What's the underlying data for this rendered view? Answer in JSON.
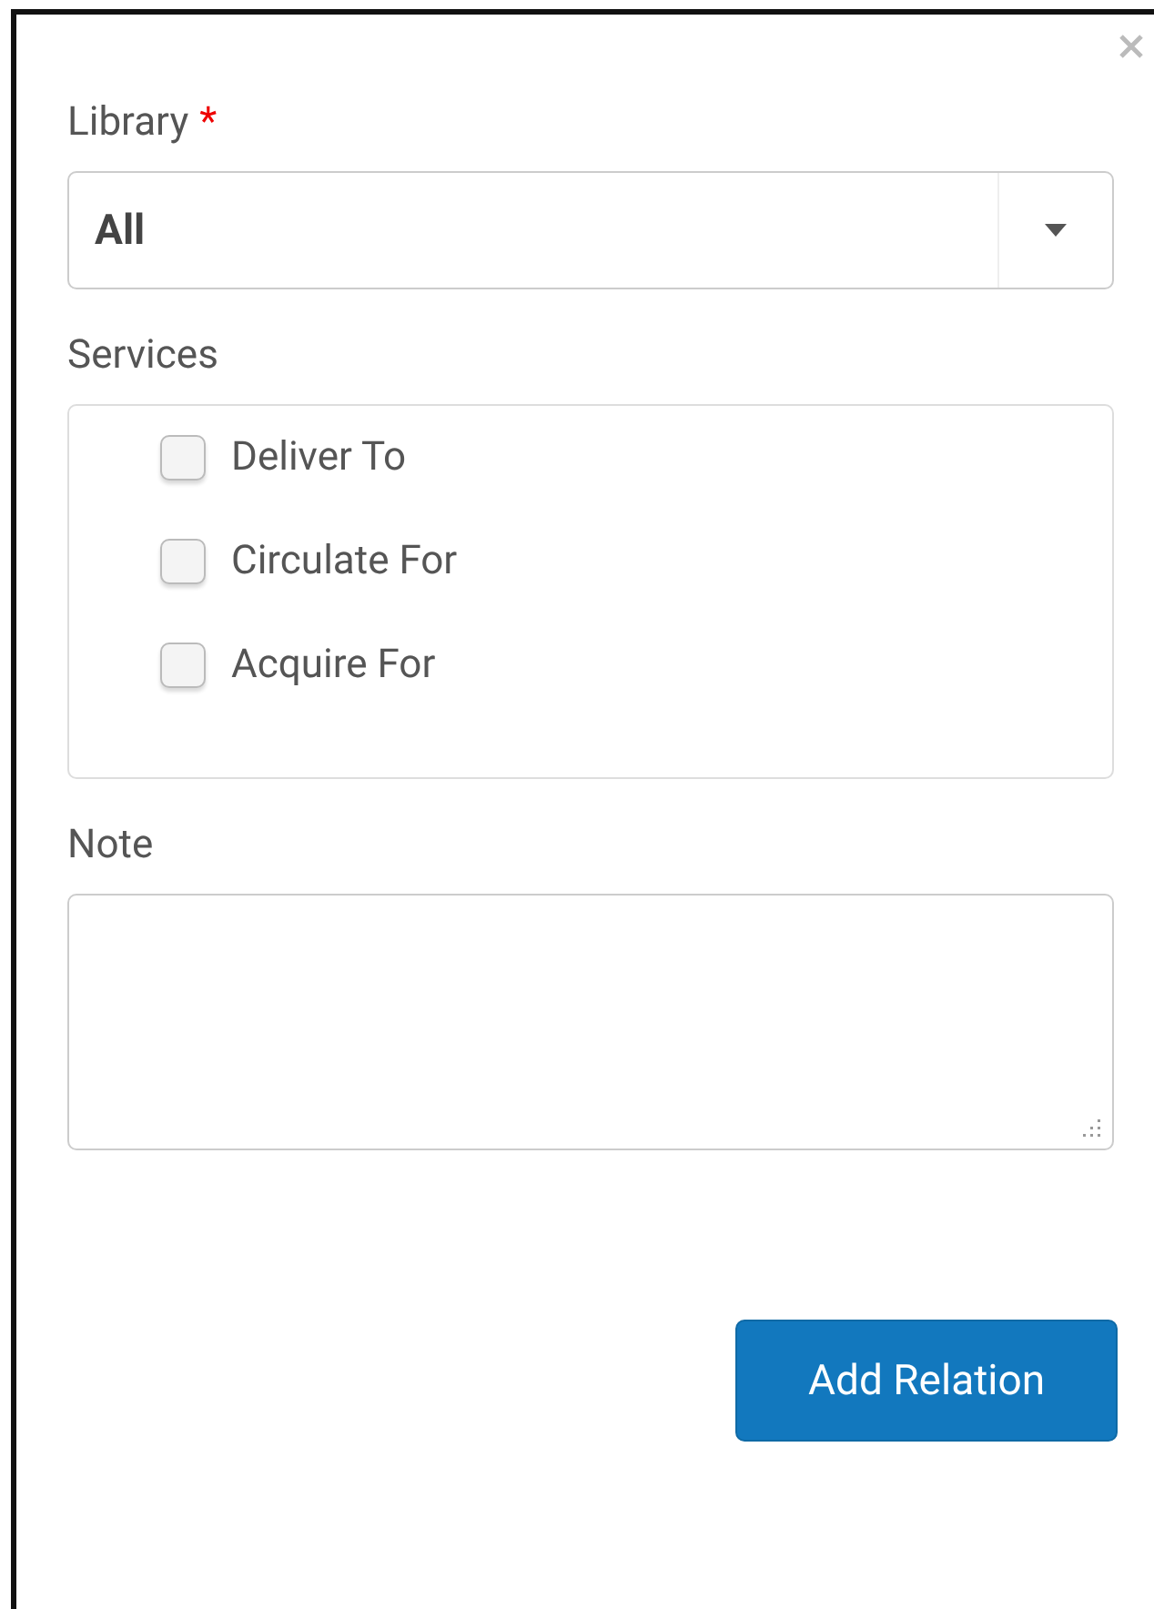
{
  "library": {
    "label": "Library",
    "required_mark": "*",
    "value": "All"
  },
  "services": {
    "label": "Services",
    "options": [
      {
        "label": "Deliver To",
        "checked": false
      },
      {
        "label": "Circulate For",
        "checked": false
      },
      {
        "label": "Acquire For",
        "checked": false
      }
    ]
  },
  "note": {
    "label": "Note"
  },
  "buttons": [
    {
      "label": "Add Relation"
    }
  ]
}
